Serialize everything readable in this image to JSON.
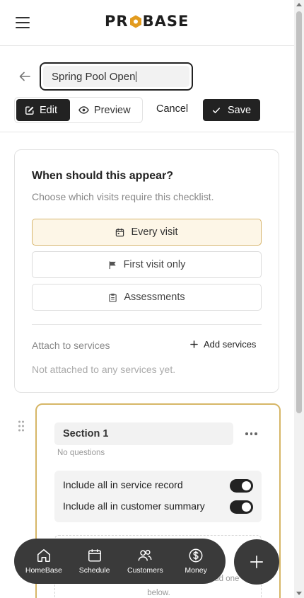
{
  "header": {
    "logo_text_pre": "PR",
    "logo_text_post": "BASE"
  },
  "editor": {
    "name_value": "Spring Pool Open",
    "edit_label": "Edit",
    "preview_label": "Preview",
    "cancel_label": "Cancel",
    "save_label": "Save"
  },
  "appear_card": {
    "title": "When should this appear?",
    "subtitle": "Choose which visits require this checklist.",
    "options": [
      {
        "label": "Every visit",
        "icon": "calendar-icon",
        "selected": true
      },
      {
        "label": "First visit only",
        "icon": "flag-icon",
        "selected": false
      },
      {
        "label": "Assessments",
        "icon": "clipboard-icon",
        "selected": false
      }
    ],
    "attach_label": "Attach to services",
    "add_services_label": "Add services",
    "not_attached_text": "Not attached to any services yet."
  },
  "section": {
    "name": "Section 1",
    "question_count_text": "No questions",
    "toggles": [
      {
        "label": "Include all in service record",
        "on": true
      },
      {
        "label": "Include all in customer summary",
        "on": true
      }
    ],
    "dropzone_hint_line1": "... or add one",
    "dropzone_hint_line2": "below."
  },
  "bottom_nav": {
    "items": [
      {
        "label": "HomeBase",
        "icon": "home-icon"
      },
      {
        "label": "Schedule",
        "icon": "calendar-icon"
      },
      {
        "label": "Customers",
        "icon": "users-icon"
      },
      {
        "label": "Money",
        "icon": "dollar-icon"
      }
    ],
    "fab_icon": "plus-icon"
  },
  "colors": {
    "accent_gold": "#d6b666",
    "selected_bg": "#fdf6e7",
    "dark": "#222222",
    "nav_bg": "#3a3a3a"
  }
}
